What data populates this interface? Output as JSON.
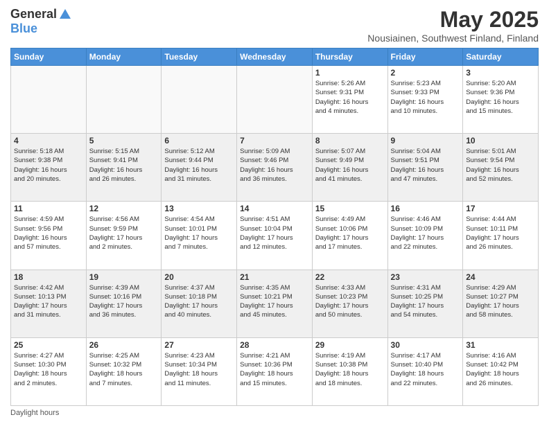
{
  "logo": {
    "general": "General",
    "blue": "Blue"
  },
  "header": {
    "month": "May 2025",
    "location": "Nousiainen, Southwest Finland, Finland"
  },
  "weekdays": [
    "Sunday",
    "Monday",
    "Tuesday",
    "Wednesday",
    "Thursday",
    "Friday",
    "Saturday"
  ],
  "footer": {
    "daylight_label": "Daylight hours"
  },
  "weeks": [
    [
      {
        "day": "",
        "info": ""
      },
      {
        "day": "",
        "info": ""
      },
      {
        "day": "",
        "info": ""
      },
      {
        "day": "",
        "info": ""
      },
      {
        "day": "1",
        "info": "Sunrise: 5:26 AM\nSunset: 9:31 PM\nDaylight: 16 hours\nand 4 minutes."
      },
      {
        "day": "2",
        "info": "Sunrise: 5:23 AM\nSunset: 9:33 PM\nDaylight: 16 hours\nand 10 minutes."
      },
      {
        "day": "3",
        "info": "Sunrise: 5:20 AM\nSunset: 9:36 PM\nDaylight: 16 hours\nand 15 minutes."
      }
    ],
    [
      {
        "day": "4",
        "info": "Sunrise: 5:18 AM\nSunset: 9:38 PM\nDaylight: 16 hours\nand 20 minutes."
      },
      {
        "day": "5",
        "info": "Sunrise: 5:15 AM\nSunset: 9:41 PM\nDaylight: 16 hours\nand 26 minutes."
      },
      {
        "day": "6",
        "info": "Sunrise: 5:12 AM\nSunset: 9:44 PM\nDaylight: 16 hours\nand 31 minutes."
      },
      {
        "day": "7",
        "info": "Sunrise: 5:09 AM\nSunset: 9:46 PM\nDaylight: 16 hours\nand 36 minutes."
      },
      {
        "day": "8",
        "info": "Sunrise: 5:07 AM\nSunset: 9:49 PM\nDaylight: 16 hours\nand 41 minutes."
      },
      {
        "day": "9",
        "info": "Sunrise: 5:04 AM\nSunset: 9:51 PM\nDaylight: 16 hours\nand 47 minutes."
      },
      {
        "day": "10",
        "info": "Sunrise: 5:01 AM\nSunset: 9:54 PM\nDaylight: 16 hours\nand 52 minutes."
      }
    ],
    [
      {
        "day": "11",
        "info": "Sunrise: 4:59 AM\nSunset: 9:56 PM\nDaylight: 16 hours\nand 57 minutes."
      },
      {
        "day": "12",
        "info": "Sunrise: 4:56 AM\nSunset: 9:59 PM\nDaylight: 17 hours\nand 2 minutes."
      },
      {
        "day": "13",
        "info": "Sunrise: 4:54 AM\nSunset: 10:01 PM\nDaylight: 17 hours\nand 7 minutes."
      },
      {
        "day": "14",
        "info": "Sunrise: 4:51 AM\nSunset: 10:04 PM\nDaylight: 17 hours\nand 12 minutes."
      },
      {
        "day": "15",
        "info": "Sunrise: 4:49 AM\nSunset: 10:06 PM\nDaylight: 17 hours\nand 17 minutes."
      },
      {
        "day": "16",
        "info": "Sunrise: 4:46 AM\nSunset: 10:09 PM\nDaylight: 17 hours\nand 22 minutes."
      },
      {
        "day": "17",
        "info": "Sunrise: 4:44 AM\nSunset: 10:11 PM\nDaylight: 17 hours\nand 26 minutes."
      }
    ],
    [
      {
        "day": "18",
        "info": "Sunrise: 4:42 AM\nSunset: 10:13 PM\nDaylight: 17 hours\nand 31 minutes."
      },
      {
        "day": "19",
        "info": "Sunrise: 4:39 AM\nSunset: 10:16 PM\nDaylight: 17 hours\nand 36 minutes."
      },
      {
        "day": "20",
        "info": "Sunrise: 4:37 AM\nSunset: 10:18 PM\nDaylight: 17 hours\nand 40 minutes."
      },
      {
        "day": "21",
        "info": "Sunrise: 4:35 AM\nSunset: 10:21 PM\nDaylight: 17 hours\nand 45 minutes."
      },
      {
        "day": "22",
        "info": "Sunrise: 4:33 AM\nSunset: 10:23 PM\nDaylight: 17 hours\nand 50 minutes."
      },
      {
        "day": "23",
        "info": "Sunrise: 4:31 AM\nSunset: 10:25 PM\nDaylight: 17 hours\nand 54 minutes."
      },
      {
        "day": "24",
        "info": "Sunrise: 4:29 AM\nSunset: 10:27 PM\nDaylight: 17 hours\nand 58 minutes."
      }
    ],
    [
      {
        "day": "25",
        "info": "Sunrise: 4:27 AM\nSunset: 10:30 PM\nDaylight: 18 hours\nand 2 minutes."
      },
      {
        "day": "26",
        "info": "Sunrise: 4:25 AM\nSunset: 10:32 PM\nDaylight: 18 hours\nand 7 minutes."
      },
      {
        "day": "27",
        "info": "Sunrise: 4:23 AM\nSunset: 10:34 PM\nDaylight: 18 hours\nand 11 minutes."
      },
      {
        "day": "28",
        "info": "Sunrise: 4:21 AM\nSunset: 10:36 PM\nDaylight: 18 hours\nand 15 minutes."
      },
      {
        "day": "29",
        "info": "Sunrise: 4:19 AM\nSunset: 10:38 PM\nDaylight: 18 hours\nand 18 minutes."
      },
      {
        "day": "30",
        "info": "Sunrise: 4:17 AM\nSunset: 10:40 PM\nDaylight: 18 hours\nand 22 minutes."
      },
      {
        "day": "31",
        "info": "Sunrise: 4:16 AM\nSunset: 10:42 PM\nDaylight: 18 hours\nand 26 minutes."
      }
    ]
  ]
}
